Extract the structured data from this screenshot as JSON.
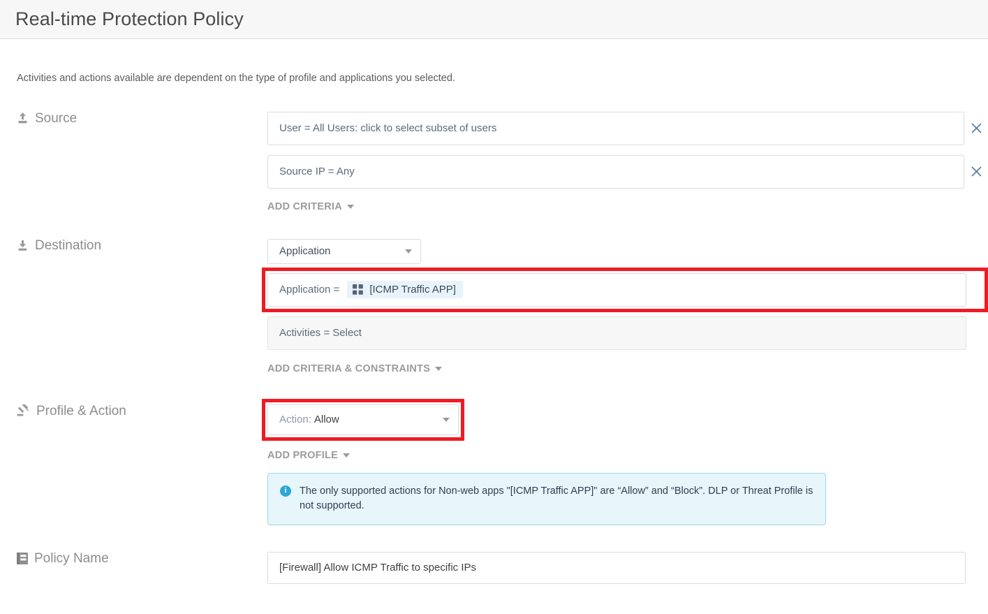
{
  "header": {
    "title": "Real-time Protection Policy"
  },
  "intro": {
    "text": "Activities and actions available are dependent on the type of profile and applications you selected."
  },
  "source": {
    "label": "Source",
    "icon": "upload-icon",
    "criteria": [
      {
        "text": "User = All Users: click to select subset of users",
        "remove_icon": "close-icon"
      },
      {
        "text": "Source IP = Any",
        "remove_icon": "close-icon"
      }
    ],
    "add_link": "ADD CRITERIA"
  },
  "destination": {
    "label": "Destination",
    "icon": "download-icon",
    "type_select": {
      "value": "Application",
      "caret_icon": "chevron-down-icon"
    },
    "application_row": {
      "prefix": "Application =",
      "chip": {
        "label": "[ICMP Traffic APP]",
        "icon": "app-grid-icon"
      },
      "highlighted": true
    },
    "activities_row": {
      "text": "Activities = Select"
    },
    "add_link": "ADD CRITERIA & CONSTRAINTS"
  },
  "profile_action": {
    "label": "Profile & Action",
    "icon": "gavel-icon",
    "action_select": {
      "prefix": "Action:",
      "value": "Allow",
      "caret_icon": "chevron-down-icon",
      "highlighted": true
    },
    "add_link": "ADD PROFILE",
    "info_banner": {
      "icon": "info-icon",
      "text": "The only supported actions for Non-web apps \"[ICMP Traffic APP]\" are “Allow” and “Block”. DLP or Threat Profile is not supported."
    }
  },
  "policy_name": {
    "label": "Policy Name",
    "icon": "document-icon",
    "input_value": "[Firewall] Allow ICMP Traffic to specific IPs",
    "input_placeholder": "Policy Name"
  },
  "colors": {
    "highlight_red": "#ed1c24",
    "info_border": "#9ed5e8",
    "info_bg": "#e6f6fb",
    "chip_bg": "#e8f4fb",
    "header_bg": "#f7f7f7"
  }
}
